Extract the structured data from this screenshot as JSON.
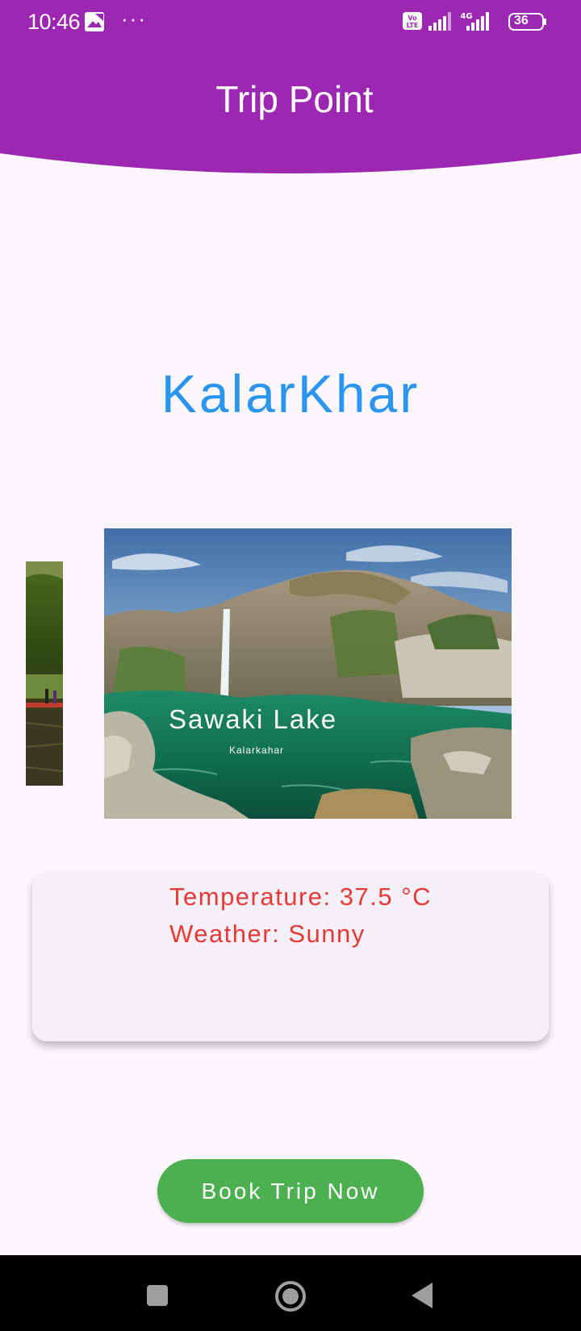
{
  "status_bar": {
    "time": "10:46",
    "more": "···",
    "battery": "36"
  },
  "app_bar": {
    "title": "Trip Point",
    "color": "#9c27b0"
  },
  "destination": {
    "title": "KalarKhar",
    "color": "#2b95ef"
  },
  "carousel": {
    "current": {
      "name": "Sawaki Lake",
      "location": "Kalarkahar"
    }
  },
  "weather": {
    "temperature": "Temperature: 37.5 °C",
    "condition": "Weather: Sunny",
    "color": "#e53935"
  },
  "actions": {
    "book_label": "Book Trip Now",
    "book_color": "#4caf50"
  },
  "nav": {
    "icons": [
      "recent-apps-icon",
      "home-icon",
      "back-icon"
    ]
  }
}
